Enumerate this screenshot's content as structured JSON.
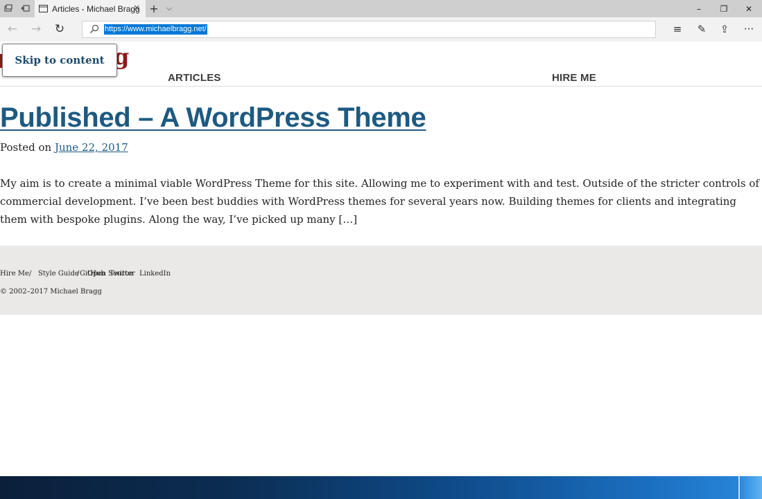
{
  "browser": {
    "tab_title": "Articles - Michael Bragg",
    "tab_close": "×",
    "new_tab": "+",
    "tab_list": "⌵",
    "url": "https://www.michaelbragg.net/",
    "minimize": "–",
    "restore": "❐",
    "close": "✕",
    "back": "←",
    "forward": "→",
    "refresh": "↻",
    "reading_view": "≡",
    "notes": "✎",
    "share": "⇪",
    "more": "···"
  },
  "site": {
    "logo_fragment": "g",
    "skip_link": "Skip to content",
    "nav": [
      "ARTICLES",
      "HIRE ME"
    ]
  },
  "post": {
    "title": "Published – A WordPress Theme",
    "posted_on_label": "Posted on",
    "date": "June 22, 2017",
    "excerpt": "My aim is to create a minimal viable WordPress Theme for this site. Allowing me to experiment with and test. Outside of the stricter controls of commercial development. I’ve been best buddies with WordPress themes for several years now. Building themes for clients and integrating them with bespoke plugins. Along the way, I’ve picked up many […]"
  },
  "footer": {
    "links": [
      "Hire Me",
      "/",
      "Style Guide",
      "/",
      "GitHub",
      "Open Source",
      "Twitter",
      "LinkedIn"
    ],
    "copyright": "© 2002–2017 Michael Bragg"
  },
  "colors": {
    "link": "#1d5a82",
    "logo_red": "#8b1a1a",
    "footer_bg": "#ebe9e8",
    "selection": "#0078d7"
  }
}
